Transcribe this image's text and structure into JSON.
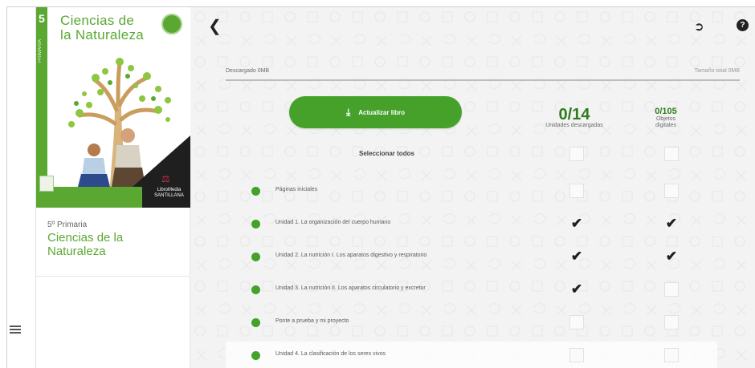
{
  "app": {
    "accent": "#5aa832"
  },
  "book": {
    "cover_number": "5",
    "cover_title_line1": "Ciencias de",
    "cover_title_line2": "la Naturaleza",
    "cover_side_text": "PRIMARIA",
    "publisher_line1": "LibroMedia",
    "publisher_line2": "SANTILLANA",
    "grade": "5º Primaria",
    "subject_line1": "Ciencias de la",
    "subject_line2": "Naturaleza"
  },
  "toolbar": {
    "back_icon": "chevron-left-icon",
    "logout_icon": "logout-icon",
    "help_label": "?"
  },
  "download": {
    "downloaded_label": "Descargado 0MB",
    "total_label": "Tamaño total 0MB",
    "progress_fraction": 0.0,
    "update_button_label": "Actualizar libro"
  },
  "stats": {
    "units_value": "0/14",
    "units_caption": "Unidades descargadas",
    "objects_value": "0/105",
    "objects_caption_line1": "Objetos",
    "objects_caption_line2": "digitales"
  },
  "select_all": {
    "label": "Seleccionar todos",
    "units_checked": false,
    "objects_checked": false
  },
  "units": [
    {
      "title": "Páginas iniciales",
      "units_checked": false,
      "objects_checked": false
    },
    {
      "title": "Unidad 1. La organización del cuerpo humano",
      "units_checked": true,
      "objects_checked": true
    },
    {
      "title": "Unidad 2. La nutrición I. Los aparatos digestivo y respiratorio",
      "units_checked": true,
      "objects_checked": true
    },
    {
      "title": "Unidad 3. La nutrición II. Los aparatos circulatorio y excretor",
      "units_checked": true,
      "objects_checked": false
    },
    {
      "title": "Ponte a prueba y mi proyecto",
      "units_checked": false,
      "objects_checked": false
    },
    {
      "title": "Unidad 4. La clasificación de los seres vivos",
      "units_checked": false,
      "objects_checked": false
    }
  ]
}
